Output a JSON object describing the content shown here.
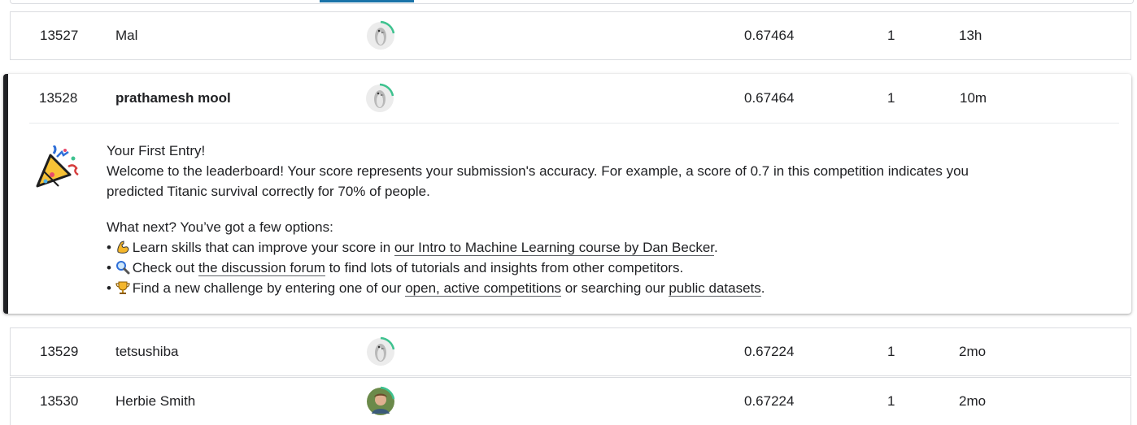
{
  "colors": {
    "progress_ring": "#20beff",
    "progress_ring_green": "#3ec28f",
    "highlight_border": "#202124",
    "tab_underline": "#1a73a8"
  },
  "rows_before": [
    {
      "rank": "13527",
      "name": "Mal",
      "avatar": "penguin-default-icon",
      "score": "0.67464",
      "entries": "1",
      "last": "13h"
    }
  ],
  "highlighted": {
    "rank": "13528",
    "name": "prathamesh mool",
    "avatar": "penguin-default-icon",
    "score": "0.67464",
    "entries": "1",
    "last": "10m",
    "message": {
      "icon": "party-popper-icon",
      "title": "Your First Entry!",
      "line1": "Welcome to the leaderboard! Your score represents your submission's accuracy. For example, a score of 0.7 in this competition indicates you",
      "line2": "predicted Titanic survival correctly for 70% of people.",
      "next_heading": "What next? You’ve got a few options:",
      "tip1_before": "Learn skills that can improve your score in ",
      "tip1_link": "our Intro to Machine Learning course by Dan Becker",
      "tip1_after": ".",
      "tip2_before": "Check out ",
      "tip2_link": "the discussion forum",
      "tip2_after": " to find lots of tutorials and insights from other competitors.",
      "tip3_before": "Find a new challenge by entering one of our ",
      "tip3_link": "open, active competitions",
      "tip3_middle": " or searching our ",
      "tip3_link2": "public datasets",
      "tip3_after": "."
    }
  },
  "rows_after": [
    {
      "rank": "13529",
      "name": "tetsushiba",
      "avatar": "penguin-default-icon",
      "score": "0.67224",
      "entries": "1",
      "last": "2mo"
    },
    {
      "rank": "13530",
      "name": "Herbie Smith",
      "avatar": "user-photo-icon",
      "score": "0.67224",
      "entries": "1",
      "last": "2mo"
    }
  ]
}
